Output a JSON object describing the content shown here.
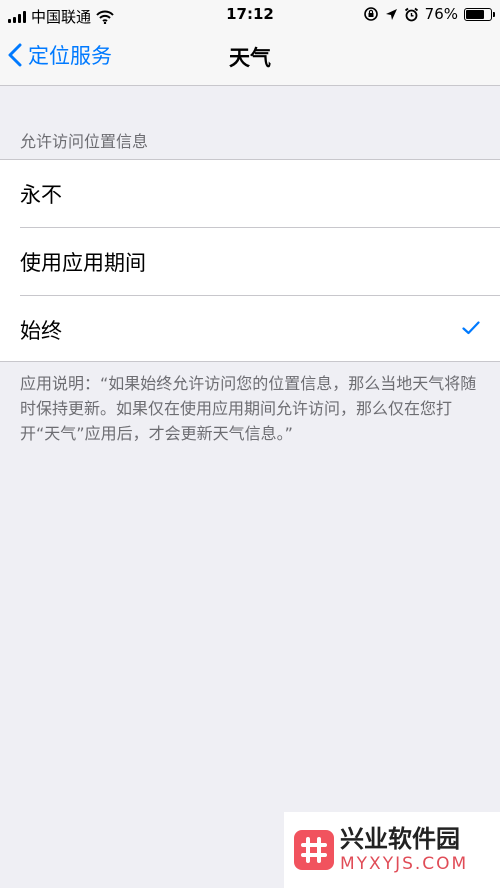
{
  "status_bar": {
    "carrier": "中国联通",
    "time": "17:12",
    "battery_percent": "76%",
    "battery_level": 0.76,
    "icons": [
      "signal-icon",
      "wifi-icon",
      "rotation-lock-icon",
      "location-arrow-icon",
      "alarm-icon",
      "battery-icon"
    ]
  },
  "nav": {
    "back_label": "定位服务",
    "title": "天气"
  },
  "section": {
    "header": "允许访问位置信息",
    "options": [
      {
        "label": "永不",
        "selected": false
      },
      {
        "label": "使用应用期间",
        "selected": false
      },
      {
        "label": "始终",
        "selected": true
      }
    ],
    "footnote": "应用说明：“如果始终允许访问您的位置信息，那么当地天气将随时保持更新。如果仅在使用应用期间允许访问，那么仅在您打开“天气”应用后，才会更新天气信息。”"
  },
  "watermark": {
    "name": "兴业软件园",
    "domain": "MYXYJS.COM"
  },
  "colors": {
    "accent": "#007aff",
    "background": "#efeff4",
    "secondary_text": "#6d6d72",
    "separator": "#c8c7cc",
    "watermark_brand": "#f1535e"
  }
}
